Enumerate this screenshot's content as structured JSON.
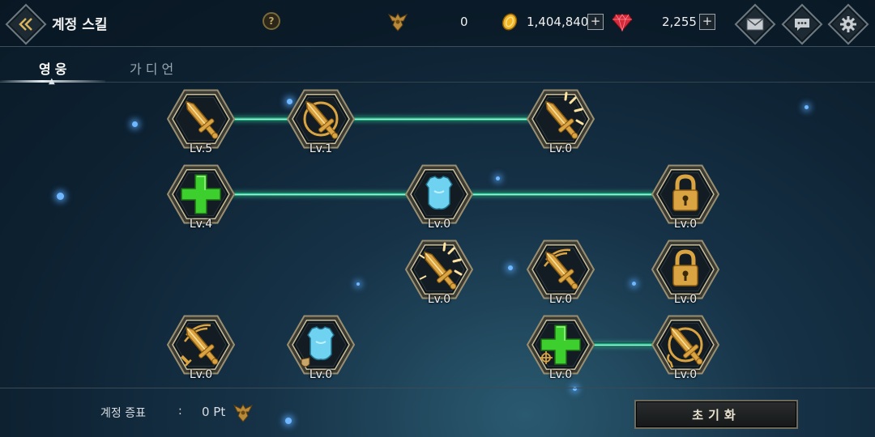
{
  "header": {
    "title": "계정 스킬",
    "help_label": "?",
    "currencies": [
      {
        "icon": "eagle-emblem-icon",
        "value": "0"
      },
      {
        "icon": "gold-coin-icon",
        "value": "1,404,840",
        "has_add": true
      },
      {
        "icon": "ruby-gem-icon",
        "value": "2,255",
        "has_add": true
      }
    ],
    "add_label": "+",
    "right_buttons": [
      "mail-icon",
      "chat-icon",
      "gear-icon"
    ]
  },
  "tabs": [
    {
      "label": "영웅",
      "active": true
    },
    {
      "label": "가디언",
      "active": false
    }
  ],
  "skills": [
    {
      "id": "r1c1",
      "icon": "sword-icon",
      "level": "Lv.5",
      "locked": false
    },
    {
      "id": "r1c2",
      "icon": "sword-ring-icon",
      "level": "Lv.1",
      "locked": false
    },
    {
      "id": "r1c4",
      "icon": "sword-burst-icon",
      "level": "Lv.0",
      "locked": false
    },
    {
      "id": "r2c1",
      "icon": "green-cross-icon",
      "level": "Lv.4",
      "locked": false
    },
    {
      "id": "r2c3",
      "icon": "armor-icon",
      "level": "Lv.0",
      "locked": false
    },
    {
      "id": "r2c5",
      "icon": "lock-icon",
      "level": "Lv.0",
      "locked": true
    },
    {
      "id": "r3c3",
      "icon": "sword-shine-icon",
      "level": "Lv.0",
      "locked": false
    },
    {
      "id": "r3c4",
      "icon": "sword-slash-icon",
      "level": "Lv.0",
      "locked": false
    },
    {
      "id": "r3c5",
      "icon": "lock-icon",
      "level": "Lv.0",
      "locked": true
    },
    {
      "id": "r4c1",
      "icon": "sword-slash-small-icon",
      "level": "Lv.0",
      "locked": false
    },
    {
      "id": "r4c2",
      "icon": "armor-shield-icon",
      "level": "Lv.0",
      "locked": false
    },
    {
      "id": "r4c4",
      "icon": "green-cross-target-icon",
      "level": "Lv.0",
      "locked": false
    },
    {
      "id": "r4c5",
      "icon": "sword-ring-hook-icon",
      "level": "Lv.0",
      "locked": false
    }
  ],
  "footer": {
    "label": "계정 증표",
    "separator": ":",
    "points": "0 Pt",
    "points_icon": "eagle-emblem-icon",
    "reset_label": "초기화"
  },
  "colors": {
    "gold": "#d9a441",
    "link_green": "#39d6a8",
    "cross_green": "#3ccf2e",
    "armor_blue": "#6fd2f0",
    "ruby": "#d42a3a"
  }
}
